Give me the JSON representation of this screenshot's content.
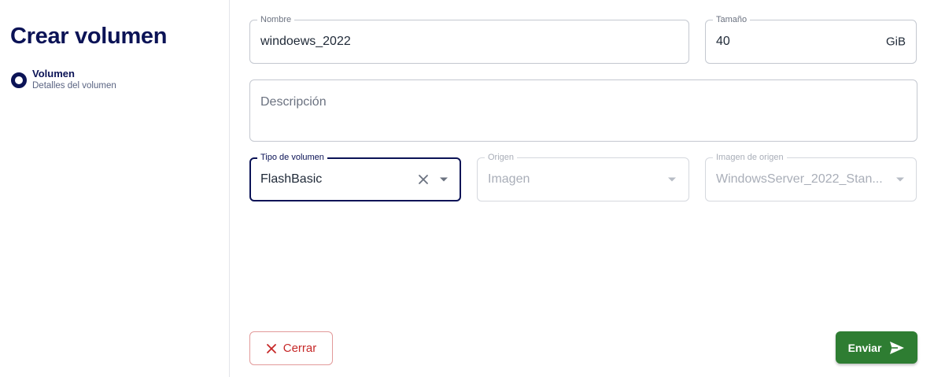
{
  "page": {
    "title": "Crear volumen"
  },
  "steps": [
    {
      "title": "Volumen",
      "subtitle": "Detalles del volumen"
    }
  ],
  "form": {
    "name": {
      "label": "Nombre",
      "value": "windoews_2022"
    },
    "size": {
      "label": "Tamaño",
      "value": "40",
      "unit": "GiB"
    },
    "description": {
      "placeholder": "Descripción"
    },
    "volume_type": {
      "label": "Tipo de volumen",
      "value": "FlashBasic"
    },
    "origin": {
      "label": "Origen",
      "value": "Imagen"
    },
    "source_image": {
      "label": "Imagen de origen",
      "value": "WindowsServer_2022_Stan..."
    }
  },
  "actions": {
    "cancel_label": "Cerrar",
    "submit_label": "Enviar"
  },
  "colors": {
    "primary": "#0b1356",
    "success": "#2e7d32",
    "danger": "#c62828",
    "border": "#c4c8d0"
  },
  "icons": {
    "step_indicator": "radio-ring-icon",
    "clear": "close-icon",
    "dropdown": "caret-down-icon",
    "cancel": "close-icon",
    "submit": "send-icon"
  }
}
